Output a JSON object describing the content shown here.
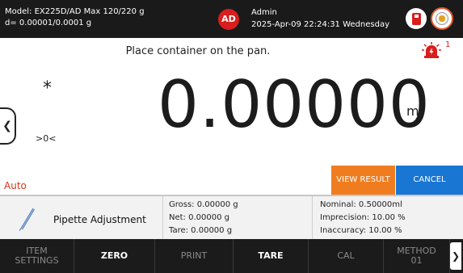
{
  "status_bar": {
    "model_line": "Model: EX225D/AD   Max 120/220 g",
    "d_line": "d= 0.00001/0.0001 g",
    "avatar": "AD",
    "user_name": "Admin",
    "datetime": "2025-Apr-09 22:24:31 Wednesday",
    "icons": [
      "usb-icon",
      "level-indicator-icon"
    ]
  },
  "weighing": {
    "prompt": "Place container on the pan.",
    "alarm_count": "1",
    "stability_mark": "*",
    "zero_indicator": ">0<",
    "weight_value": "0.00000",
    "unit": "ml",
    "mode": "Auto",
    "view_result_label": "VIEW RESULT",
    "cancel_label": "CANCEL"
  },
  "info": {
    "method_name": "Pipette Adjustment",
    "gross": "Gross: 0.00000  g",
    "net": "Net: 0.00000  g",
    "tare": "Tare: 0.00000  g",
    "nominal": "Nominal: 0.50000ml",
    "imprecision": "Imprecision: 10.00 %",
    "inaccuracy": "Inaccuracy: 10.00 %"
  },
  "softkeys": {
    "item_settings_1": "ITEM",
    "item_settings_2": "SETTINGS",
    "zero": "ZERO",
    "print": "PRINT",
    "tare": "TARE",
    "cal": "CAL",
    "method_1": "METHOD",
    "method_2": "01"
  },
  "colors": {
    "accent_orange": "#ef7d20",
    "accent_blue": "#1976d2",
    "alert_red": "#d81e1e",
    "topbar": "#1a1a1a"
  }
}
